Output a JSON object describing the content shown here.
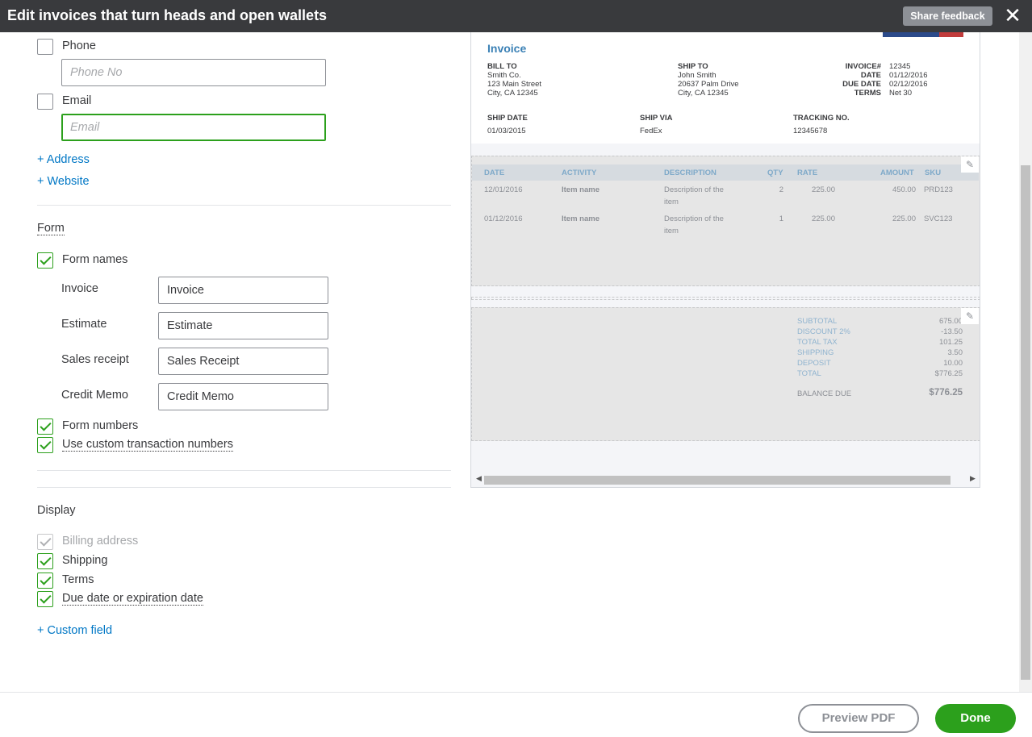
{
  "header": {
    "title": "Edit invoices that turn heads and open wallets",
    "share_feedback": "Share feedback",
    "close": "✕"
  },
  "contact": {
    "phone_label": "Phone",
    "phone_placeholder": "Phone No",
    "email_label": "Email",
    "email_placeholder": "Email",
    "add_address": "+ Address",
    "add_website": "+ Website"
  },
  "form": {
    "section_title": "Form",
    "form_names_label": "Form names",
    "names": [
      {
        "label": "Invoice",
        "value": "Invoice"
      },
      {
        "label": "Estimate",
        "value": "Estimate"
      },
      {
        "label": "Sales receipt",
        "value": "Sales Receipt"
      },
      {
        "label": "Credit Memo",
        "value": "Credit Memo"
      }
    ],
    "form_numbers_label": "Form numbers",
    "custom_numbers_label": "Use custom transaction numbers"
  },
  "display": {
    "section_title": "Display",
    "billing_address": "Billing address",
    "shipping": "Shipping",
    "terms": "Terms",
    "due_date": "Due date or expiration date",
    "custom_field": "+ Custom field"
  },
  "preview": {
    "title": "Invoice",
    "bill_to": {
      "heading": "BILL TO",
      "lines": [
        "Smith Co.",
        "123 Main Street",
        "City, CA 12345"
      ]
    },
    "ship_to": {
      "heading": "SHIP TO",
      "lines": [
        "John Smith",
        "20637 Palm Drive",
        "City, CA 12345"
      ]
    },
    "meta": [
      {
        "label": "INVOICE#",
        "value": "12345"
      },
      {
        "label": "DATE",
        "value": "01/12/2016"
      },
      {
        "label": "DUE DATE",
        "value": "02/12/2016"
      },
      {
        "label": "TERMS",
        "value": "Net 30"
      }
    ],
    "ship_date": {
      "label": "SHIP DATE",
      "value": "01/03/2015"
    },
    "ship_via": {
      "label": "SHIP VIA",
      "value": "FedEx"
    },
    "tracking": {
      "label": "TRACKING NO.",
      "value": "12345678"
    },
    "columns": [
      "DATE",
      "ACTIVITY",
      "DESCRIPTION",
      "QTY",
      "RATE",
      "AMOUNT",
      "SKU"
    ],
    "rows": [
      {
        "date": "12/01/2016",
        "activity": "Item name",
        "desc1": "Description of the",
        "desc2": "item",
        "qty": "2",
        "rate": "225.00",
        "amount": "450.00",
        "sku": "PRD123"
      },
      {
        "date": "01/12/2016",
        "activity": "Item name",
        "desc1": "Description of the",
        "desc2": "item",
        "qty": "1",
        "rate": "225.00",
        "amount": "225.00",
        "sku": "SVC123"
      }
    ],
    "totals": [
      {
        "label": "SUBTOTAL",
        "value": "675.00"
      },
      {
        "label": "DISCOUNT 2%",
        "value": "-13.50"
      },
      {
        "label": "TOTAL TAX",
        "value": "101.25"
      },
      {
        "label": "SHIPPING",
        "value": "3.50"
      },
      {
        "label": "DEPOSIT",
        "value": "10.00"
      },
      {
        "label": "TOTAL",
        "value": "$776.25"
      }
    ],
    "balance_due": {
      "label": "BALANCE DUE",
      "value": "$776.25"
    }
  },
  "footer": {
    "preview_pdf": "Preview PDF",
    "done": "Done"
  }
}
